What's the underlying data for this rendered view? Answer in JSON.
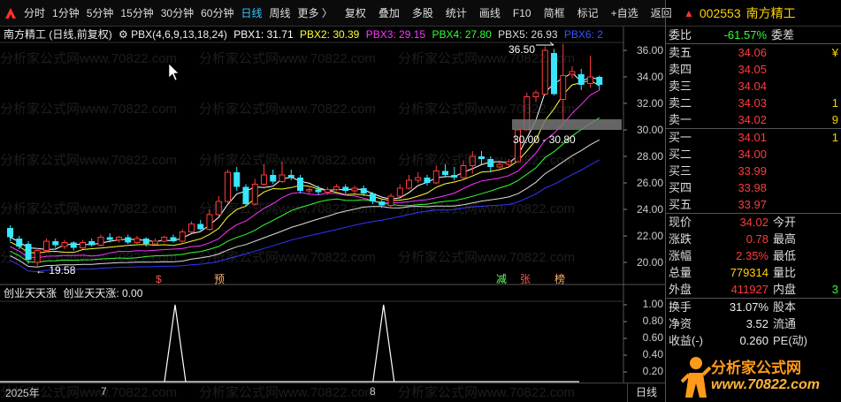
{
  "toolbar": {
    "buttons": [
      "分时",
      "1分钟",
      "5分钟",
      "15分钟",
      "30分钟",
      "60分钟",
      "日线",
      "周线",
      "更多 〉",
      "复权",
      "叠加",
      "多股",
      "统计",
      "画线",
      "F10",
      "简框",
      "标记",
      "+自选",
      "返回"
    ],
    "active": "日线"
  },
  "stock": {
    "code": "002553",
    "name": "南方精工"
  },
  "main_title": {
    "name": "南方精工",
    "mode": "(日线,前复权)",
    "formula": "PBX(4,6,9,13,18,24)",
    "pbx1": "PBX1: 31.71",
    "pbx2": "PBX2: 30.39",
    "pbx3": "PBX3: 29.15",
    "pbx4": "PBX4: 27.80",
    "pbx5": "PBX5: 26.93",
    "pbx6": "PBX6: 2"
  },
  "indicator_title": {
    "name": "创业天天涨",
    "value": "创业天天涨: 0.00"
  },
  "price_axis": [
    "36.00",
    "34.00",
    "32.00",
    "30.00",
    "28.00",
    "26.00",
    "24.00",
    "22.00",
    "20.00"
  ],
  "ind_axis": [
    "1.00",
    "0.80",
    "0.60",
    "0.40",
    "0.20"
  ],
  "annotations": {
    "high": "36.50",
    "low": "19.58",
    "box": "30.00 - 30.80"
  },
  "markers": [
    "$",
    "预",
    "减",
    "张",
    "榜"
  ],
  "date_axis": {
    "year": "2025年",
    "m7": "7",
    "m8": "8",
    "tab": "日线"
  },
  "webi": {
    "label": "委比",
    "value": "-61.57%",
    "label2": "委差"
  },
  "asks": [
    {
      "label": "卖五",
      "price": "34.06",
      "vol": "¥"
    },
    {
      "label": "卖四",
      "price": "34.05",
      "vol": ""
    },
    {
      "label": "卖三",
      "price": "34.04",
      "vol": ""
    },
    {
      "label": "卖二",
      "price": "34.03",
      "vol": "1"
    },
    {
      "label": "卖一",
      "price": "34.02",
      "vol": "9"
    }
  ],
  "bids": [
    {
      "label": "买一",
      "price": "34.01",
      "vol": "1"
    },
    {
      "label": "买二",
      "price": "34.00",
      "vol": ""
    },
    {
      "label": "买三",
      "price": "33.99",
      "vol": ""
    },
    {
      "label": "买四",
      "price": "33.98",
      "vol": ""
    },
    {
      "label": "买五",
      "price": "33.97",
      "vol": ""
    }
  ],
  "quote": [
    {
      "l1": "现价",
      "v1": "34.02",
      "l2": "今开",
      "c": "red"
    },
    {
      "l1": "涨跌",
      "v1": "0.78",
      "l2": "最高",
      "c": "red"
    },
    {
      "l1": "涨幅",
      "v1": "2.35%",
      "l2": "最低",
      "c": "red"
    },
    {
      "l1": "总量",
      "v1": "779314",
      "l2": "量比",
      "c": "yellow"
    },
    {
      "l1": "外盘",
      "v1": "411927",
      "l2": "内盘",
      "c": "red",
      "extra": "3"
    }
  ],
  "fund": [
    {
      "l1": "换手",
      "v1": "31.07%",
      "l2": "股本"
    },
    {
      "l1": "净资",
      "v1": "3.52",
      "l2": "流通"
    },
    {
      "l1": "收益(-)",
      "v1": "0.260",
      "l2": "PE(动)"
    }
  ],
  "brand": {
    "name": "分析家公式网",
    "url": "www.70822.com"
  },
  "watermark": "分析家公式网www.70822.com",
  "colors": {
    "up": "#ff3b3b",
    "down": "#37e6ff",
    "pbx1": "#ffffff",
    "pbx2": "#ffff33",
    "pbx3": "#ff33ff",
    "pbx4": "#33ff33",
    "pbx5": "#dddddd",
    "pbx6": "#3333ff"
  },
  "chart_data": {
    "type": "candlestick",
    "price_range": [
      19.0,
      37.0
    ],
    "candles": [
      [
        22.6,
        21.9,
        22.8,
        21.6
      ],
      [
        21.8,
        21.2,
        22.0,
        21.0
      ],
      [
        21.4,
        20.2,
        21.6,
        19.9
      ],
      [
        20.0,
        20.9,
        21.1,
        19.58
      ],
      [
        20.9,
        21.6,
        21.8,
        20.8
      ],
      [
        21.6,
        21.3,
        21.8,
        21.1
      ],
      [
        21.2,
        21.5,
        21.7,
        21.0
      ],
      [
        21.5,
        21.1,
        21.6,
        20.9
      ],
      [
        21.1,
        21.5,
        21.7,
        21.0
      ],
      [
        21.6,
        21.3,
        21.8,
        21.2
      ],
      [
        21.3,
        21.9,
        22.1,
        21.2
      ],
      [
        21.9,
        21.7,
        22.2,
        21.5
      ],
      [
        21.7,
        21.9,
        22.0,
        21.5
      ],
      [
        21.9,
        21.5,
        22.1,
        21.4
      ],
      [
        21.5,
        21.8,
        22.0,
        21.4
      ],
      [
        21.8,
        21.4,
        21.9,
        21.2
      ],
      [
        21.4,
        21.6,
        21.8,
        21.3
      ],
      [
        21.6,
        21.9,
        22.0,
        21.5
      ],
      [
        21.9,
        21.6,
        22.1,
        21.5
      ],
      [
        21.6,
        22.3,
        22.5,
        21.5
      ],
      [
        22.3,
        22.9,
        23.1,
        22.2
      ],
      [
        22.9,
        22.5,
        23.2,
        22.4
      ],
      [
        22.5,
        23.6,
        24.0,
        22.4
      ],
      [
        23.6,
        24.6,
        25.0,
        23.5
      ],
      [
        24.6,
        26.8,
        27.0,
        24.5
      ],
      [
        26.8,
        25.7,
        27.2,
        25.4
      ],
      [
        25.7,
        24.4,
        25.9,
        24.2
      ],
      [
        24.4,
        25.9,
        26.3,
        24.3
      ],
      [
        25.9,
        26.6,
        27.4,
        25.8
      ],
      [
        26.6,
        26.1,
        27.0,
        25.9
      ],
      [
        26.1,
        26.6,
        27.6,
        26.0
      ],
      [
        26.6,
        26.4,
        27.0,
        26.2
      ],
      [
        26.4,
        25.4,
        26.6,
        25.2
      ],
      [
        25.4,
        25.5,
        25.8,
        25.2
      ],
      [
        25.5,
        25.3,
        25.8,
        25.1
      ],
      [
        25.3,
        25.5,
        25.7,
        25.1
      ],
      [
        25.5,
        25.7,
        25.9,
        25.4
      ],
      [
        25.7,
        25.4,
        25.9,
        25.2
      ],
      [
        25.4,
        25.6,
        25.8,
        25.2
      ],
      [
        25.6,
        25.2,
        25.8,
        25.0
      ],
      [
        25.2,
        24.6,
        25.3,
        24.4
      ],
      [
        24.6,
        24.3,
        24.8,
        24.1
      ],
      [
        24.3,
        25.0,
        25.2,
        24.1
      ],
      [
        25.0,
        25.6,
        25.9,
        24.9
      ],
      [
        25.6,
        26.2,
        26.6,
        25.5
      ],
      [
        26.2,
        26.4,
        26.8,
        26.0
      ],
      [
        26.4,
        26.0,
        26.6,
        25.8
      ],
      [
        26.0,
        26.9,
        27.3,
        25.9
      ],
      [
        26.9,
        26.6,
        27.4,
        26.4
      ],
      [
        26.6,
        26.4,
        27.2,
        26.2
      ],
      [
        26.4,
        27.3,
        27.7,
        26.3
      ],
      [
        27.3,
        28.0,
        28.4,
        26.7
      ],
      [
        28.0,
        27.8,
        28.4,
        27.4
      ],
      [
        27.8,
        27.2,
        28.0,
        26.8
      ],
      [
        27.2,
        27.4,
        27.6,
        26.9
      ],
      [
        27.4,
        27.6,
        27.8,
        27.2
      ],
      [
        27.6,
        30.0,
        30.0,
        27.6
      ],
      [
        30.0,
        32.5,
        32.8,
        30.0
      ],
      [
        32.5,
        32.8,
        33.0,
        32.1
      ],
      [
        32.7,
        36.0,
        36.3,
        32.6
      ],
      [
        35.8,
        32.7,
        36.1,
        32.6
      ],
      [
        32.3,
        34.1,
        36.5,
        30.6
      ],
      [
        34.2,
        34.4,
        34.8,
        33.9
      ],
      [
        34.2,
        33.4,
        34.6,
        33.0
      ],
      [
        33.5,
        34.0,
        35.6,
        33.2
      ],
      [
        34.0,
        33.4,
        34.1,
        33.0
      ]
    ],
    "indicator": {
      "name": "创业天天涨",
      "spikes_at": [
        18,
        41
      ],
      "range": [
        0,
        1
      ]
    }
  }
}
